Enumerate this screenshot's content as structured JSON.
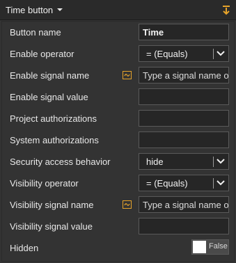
{
  "header": {
    "title": "Time button",
    "caret_icon": "caret-down-icon",
    "pin_icon": "pin-icon"
  },
  "rows": {
    "button_name": {
      "label": "Button name",
      "value": "Time"
    },
    "enable_operator": {
      "label": "Enable operator",
      "selected": "= (Equals)"
    },
    "enable_signal_name": {
      "label": "Enable signal name",
      "placeholder": "Type a signal name or select one"
    },
    "enable_signal_value": {
      "label": "Enable signal value",
      "value": ""
    },
    "project_authorizations": {
      "label": "Project authorizations",
      "value": ""
    },
    "system_authorizations": {
      "label": "System authorizations",
      "value": ""
    },
    "security_access_behavior": {
      "label": "Security access behavior",
      "selected": "hide"
    },
    "visibility_operator": {
      "label": "Visibility operator",
      "selected": "= (Equals)"
    },
    "visibility_signal_name": {
      "label": "Visibility signal name",
      "placeholder": "Type a signal name or select one"
    },
    "visibility_signal_value": {
      "label": "Visibility signal value",
      "value": ""
    },
    "hidden": {
      "label": "Hidden",
      "toggle_text": "False",
      "checked": false
    }
  },
  "colors": {
    "panel_bg": "#333333",
    "header_bg": "#2a2a2a",
    "input_bg": "#262626",
    "accent": "#e6a32a"
  }
}
